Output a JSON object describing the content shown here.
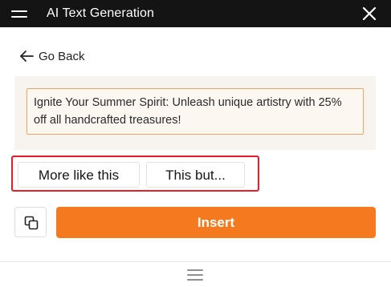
{
  "header": {
    "title": "AI Text Generation",
    "menu_icon": "hamburger-menu-icon",
    "close_icon": "close-icon"
  },
  "navigation": {
    "back_label": "Go Back",
    "back_icon": "arrow-left-icon"
  },
  "result": {
    "text": "Ignite Your Summer Spirit: Unleash unique artistry with 25% off all handcrafted treasures!"
  },
  "actions": {
    "more_like_this": "More like this",
    "this_but": "This but..."
  },
  "footer_actions": {
    "copy_icon": "copy-icon",
    "insert_label": "Insert"
  },
  "colors": {
    "header_bg": "#141414",
    "accent": "#f57a1f",
    "highlight_border": "#ea1b2a",
    "result_border": "#f0a46a",
    "panel_bg": "#f7f4f0"
  }
}
